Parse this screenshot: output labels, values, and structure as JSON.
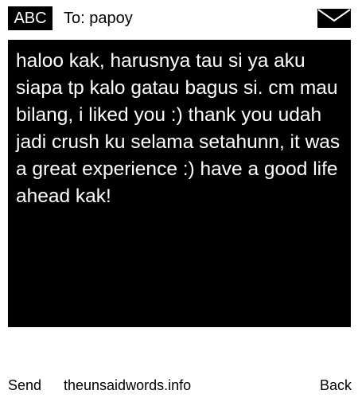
{
  "header": {
    "input_mode": "ABC",
    "recipient": "To: papoy",
    "icon": "envelope-icon"
  },
  "message": {
    "text": "haloo kak, harusnya tau si ya aku siapa tp kalo gatau bagus si. cm mau bilang, i liked you :) thank you udah jadi crush ku selama setahunn, it was a great experience :) have a good life ahead kak!"
  },
  "footer": {
    "left_softkey": "Send",
    "site": "theunsaidwords.info",
    "right_softkey": "Back"
  },
  "colors": {
    "background": "#ffffff",
    "message_background": "#000000",
    "message_text": "#ffffff",
    "text": "#000000"
  }
}
